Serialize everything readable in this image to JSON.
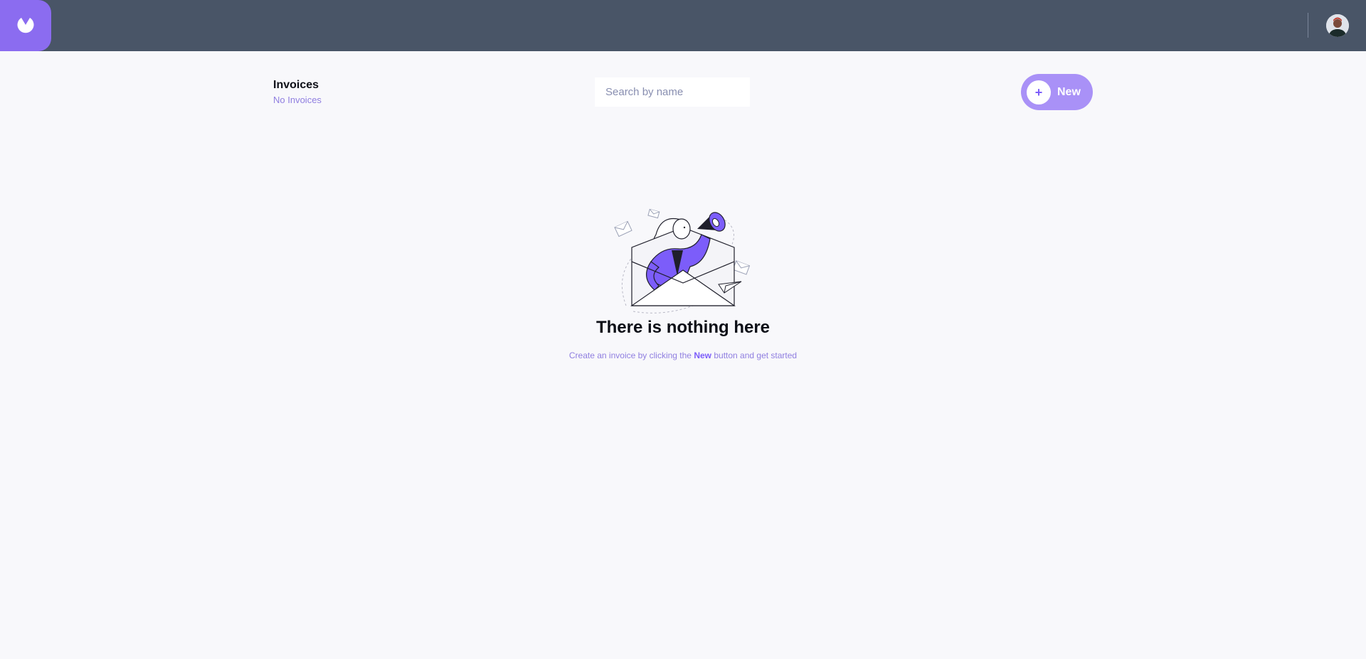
{
  "header": {
    "logo_icon": "app-logo-icon",
    "avatar_icon": "user-avatar",
    "brand_color": "#8b6cf0",
    "bar_color": "#495567"
  },
  "invoices": {
    "title": "Invoices",
    "count_text": "No Invoices"
  },
  "search": {
    "placeholder": "Search by name",
    "value": ""
  },
  "toolbar": {
    "new_label": "New",
    "new_icon": "plus-icon",
    "accent": "#a991f7"
  },
  "empty_state": {
    "illustration": "woman-megaphone-envelope-illustration",
    "title": "There is nothing here",
    "desc_before": "Create an invoice by clicking the ",
    "desc_bold": "New",
    "desc_after": " button and get started"
  }
}
